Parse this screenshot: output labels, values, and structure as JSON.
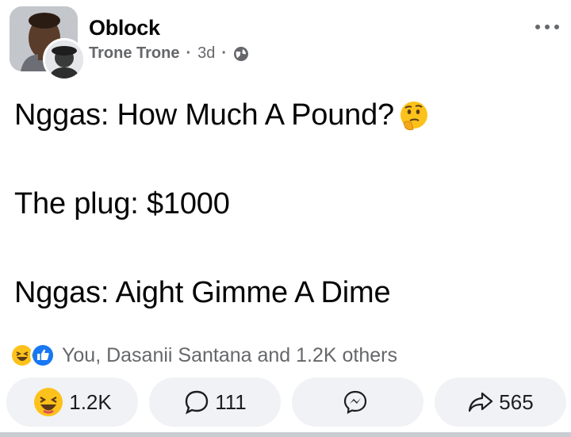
{
  "post": {
    "group_name": "Oblock",
    "author": "Trone Trone",
    "time": "3d",
    "separator": "·",
    "lines": [
      "Nggas: How Much A Pound?",
      "The plug: $1000",
      "Nggas: Aight Gimme A Dime"
    ]
  },
  "reactions": {
    "summary": "You, Dasanii Santana and 1.2K others",
    "icons": [
      "haha-icon",
      "like-icon"
    ]
  },
  "actions": {
    "react_count": "1.2K",
    "comment_count": "111",
    "share_count": "565"
  },
  "colors": {
    "secondary_text": "#65676b",
    "like_blue": "#1877f2",
    "button_bg": "#f0f2f5"
  }
}
